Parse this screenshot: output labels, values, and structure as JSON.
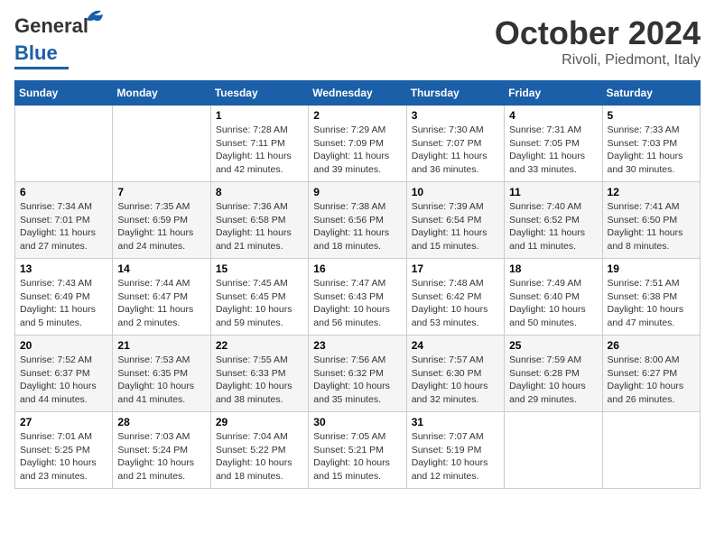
{
  "header": {
    "logo_general": "General",
    "logo_blue": "Blue",
    "month_title": "October 2024",
    "location": "Rivoli, Piedmont, Italy"
  },
  "weekdays": [
    "Sunday",
    "Monday",
    "Tuesday",
    "Wednesday",
    "Thursday",
    "Friday",
    "Saturday"
  ],
  "weeks": [
    [
      null,
      null,
      {
        "day": "1",
        "sunrise": "7:28 AM",
        "sunset": "7:11 PM",
        "daylight": "11 hours and 42 minutes."
      },
      {
        "day": "2",
        "sunrise": "7:29 AM",
        "sunset": "7:09 PM",
        "daylight": "11 hours and 39 minutes."
      },
      {
        "day": "3",
        "sunrise": "7:30 AM",
        "sunset": "7:07 PM",
        "daylight": "11 hours and 36 minutes."
      },
      {
        "day": "4",
        "sunrise": "7:31 AM",
        "sunset": "7:05 PM",
        "daylight": "11 hours and 33 minutes."
      },
      {
        "day": "5",
        "sunrise": "7:33 AM",
        "sunset": "7:03 PM",
        "daylight": "11 hours and 30 minutes."
      }
    ],
    [
      {
        "day": "6",
        "sunrise": "7:34 AM",
        "sunset": "7:01 PM",
        "daylight": "11 hours and 27 minutes."
      },
      {
        "day": "7",
        "sunrise": "7:35 AM",
        "sunset": "6:59 PM",
        "daylight": "11 hours and 24 minutes."
      },
      {
        "day": "8",
        "sunrise": "7:36 AM",
        "sunset": "6:58 PM",
        "daylight": "11 hours and 21 minutes."
      },
      {
        "day": "9",
        "sunrise": "7:38 AM",
        "sunset": "6:56 PM",
        "daylight": "11 hours and 18 minutes."
      },
      {
        "day": "10",
        "sunrise": "7:39 AM",
        "sunset": "6:54 PM",
        "daylight": "11 hours and 15 minutes."
      },
      {
        "day": "11",
        "sunrise": "7:40 AM",
        "sunset": "6:52 PM",
        "daylight": "11 hours and 11 minutes."
      },
      {
        "day": "12",
        "sunrise": "7:41 AM",
        "sunset": "6:50 PM",
        "daylight": "11 hours and 8 minutes."
      }
    ],
    [
      {
        "day": "13",
        "sunrise": "7:43 AM",
        "sunset": "6:49 PM",
        "daylight": "11 hours and 5 minutes."
      },
      {
        "day": "14",
        "sunrise": "7:44 AM",
        "sunset": "6:47 PM",
        "daylight": "11 hours and 2 minutes."
      },
      {
        "day": "15",
        "sunrise": "7:45 AM",
        "sunset": "6:45 PM",
        "daylight": "10 hours and 59 minutes."
      },
      {
        "day": "16",
        "sunrise": "7:47 AM",
        "sunset": "6:43 PM",
        "daylight": "10 hours and 56 minutes."
      },
      {
        "day": "17",
        "sunrise": "7:48 AM",
        "sunset": "6:42 PM",
        "daylight": "10 hours and 53 minutes."
      },
      {
        "day": "18",
        "sunrise": "7:49 AM",
        "sunset": "6:40 PM",
        "daylight": "10 hours and 50 minutes."
      },
      {
        "day": "19",
        "sunrise": "7:51 AM",
        "sunset": "6:38 PM",
        "daylight": "10 hours and 47 minutes."
      }
    ],
    [
      {
        "day": "20",
        "sunrise": "7:52 AM",
        "sunset": "6:37 PM",
        "daylight": "10 hours and 44 minutes."
      },
      {
        "day": "21",
        "sunrise": "7:53 AM",
        "sunset": "6:35 PM",
        "daylight": "10 hours and 41 minutes."
      },
      {
        "day": "22",
        "sunrise": "7:55 AM",
        "sunset": "6:33 PM",
        "daylight": "10 hours and 38 minutes."
      },
      {
        "day": "23",
        "sunrise": "7:56 AM",
        "sunset": "6:32 PM",
        "daylight": "10 hours and 35 minutes."
      },
      {
        "day": "24",
        "sunrise": "7:57 AM",
        "sunset": "6:30 PM",
        "daylight": "10 hours and 32 minutes."
      },
      {
        "day": "25",
        "sunrise": "7:59 AM",
        "sunset": "6:28 PM",
        "daylight": "10 hours and 29 minutes."
      },
      {
        "day": "26",
        "sunrise": "8:00 AM",
        "sunset": "6:27 PM",
        "daylight": "10 hours and 26 minutes."
      }
    ],
    [
      {
        "day": "27",
        "sunrise": "7:01 AM",
        "sunset": "5:25 PM",
        "daylight": "10 hours and 23 minutes."
      },
      {
        "day": "28",
        "sunrise": "7:03 AM",
        "sunset": "5:24 PM",
        "daylight": "10 hours and 21 minutes."
      },
      {
        "day": "29",
        "sunrise": "7:04 AM",
        "sunset": "5:22 PM",
        "daylight": "10 hours and 18 minutes."
      },
      {
        "day": "30",
        "sunrise": "7:05 AM",
        "sunset": "5:21 PM",
        "daylight": "10 hours and 15 minutes."
      },
      {
        "day": "31",
        "sunrise": "7:07 AM",
        "sunset": "5:19 PM",
        "daylight": "10 hours and 12 minutes."
      },
      null,
      null
    ]
  ],
  "labels": {
    "sunrise_label": "Sunrise:",
    "sunset_label": "Sunset:",
    "daylight_label": "Daylight:"
  }
}
